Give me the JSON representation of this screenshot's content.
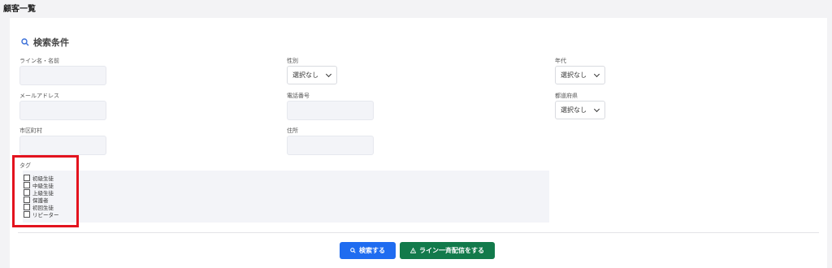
{
  "header": {
    "title": "顧客一覧"
  },
  "search": {
    "section_title": "検索条件",
    "fields": {
      "line_name": {
        "label": "ライン名・名前",
        "value": ""
      },
      "gender": {
        "label": "性別",
        "value": "選択なし"
      },
      "age": {
        "label": "年代",
        "value": "選択なし"
      },
      "email": {
        "label": "メールアドレス",
        "value": ""
      },
      "phone": {
        "label": "電話番号",
        "value": ""
      },
      "prefecture": {
        "label": "都道府県",
        "value": "選択なし"
      },
      "city": {
        "label": "市区町村",
        "value": ""
      },
      "address": {
        "label": "住所",
        "value": ""
      }
    },
    "tags": {
      "label": "タグ",
      "items": [
        "初級生徒",
        "中級生徒",
        "上級生徒",
        "保護者",
        "初回生徒",
        "リピーター"
      ]
    }
  },
  "actions": {
    "search_label": "検索する",
    "line_broadcast_label": "ライン一斉配信をする"
  },
  "colors": {
    "search_button": "#1f6cf0",
    "line_button": "#127a4b",
    "highlight_border": "#e3131e"
  }
}
